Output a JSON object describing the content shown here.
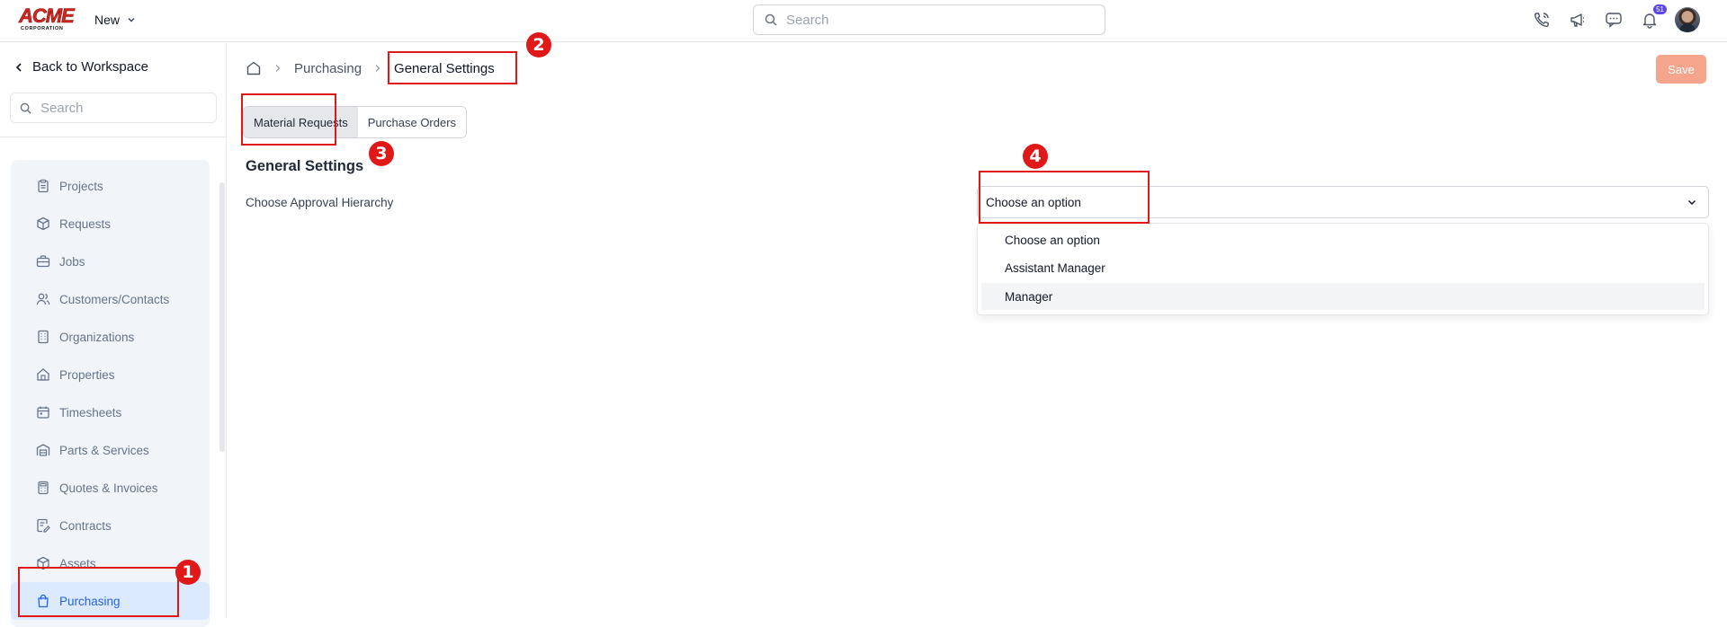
{
  "header": {
    "logo_text": "ACME",
    "logo_subtext": "CORPORATION",
    "new_label": "New",
    "search_placeholder": "Search",
    "notification_count": "51",
    "icons": [
      "phone-icon",
      "megaphone-icon",
      "chat-icon",
      "bell-icon"
    ]
  },
  "sidebar": {
    "back_label": "Back to Workspace",
    "search_placeholder": "Search",
    "items": [
      {
        "label": "Projects",
        "icon": "clipboard-icon"
      },
      {
        "label": "Requests",
        "icon": "package-icon"
      },
      {
        "label": "Jobs",
        "icon": "briefcase-icon"
      },
      {
        "label": "Customers/Contacts",
        "icon": "users-icon"
      },
      {
        "label": "Organizations",
        "icon": "building-icon"
      },
      {
        "label": "Properties",
        "icon": "house-icon"
      },
      {
        "label": "Timesheets",
        "icon": "calendar-icon"
      },
      {
        "label": "Parts & Services",
        "icon": "warehouse-icon"
      },
      {
        "label": "Quotes & Invoices",
        "icon": "calculator-icon"
      },
      {
        "label": "Contracts",
        "icon": "contract-icon"
      },
      {
        "label": "Assets",
        "icon": "cube-icon"
      },
      {
        "label": "Purchasing",
        "icon": "shopping-bag-icon",
        "active": true
      }
    ]
  },
  "breadcrumb": {
    "items": [
      "Purchasing",
      "General Settings"
    ]
  },
  "toolbar": {
    "save_label": "Save"
  },
  "tabs": [
    {
      "label": "Material Requests",
      "active": true
    },
    {
      "label": "Purchase Orders",
      "active": false
    }
  ],
  "settings": {
    "title": "General Settings",
    "approval_label": "Choose Approval Hierarchy",
    "approval_value": "Choose an option",
    "options": [
      "Choose an option",
      "Assistant Manager",
      "Manager"
    ],
    "highlighted_option": "Manager"
  },
  "annotations": [
    "1",
    "2",
    "3",
    "4"
  ],
  "colors": {
    "accent": "#2563eb",
    "active_bg": "#dbeafe",
    "save_bg": "#f4a58c",
    "annotation": "#e01818",
    "badge": "#5b46e6"
  }
}
